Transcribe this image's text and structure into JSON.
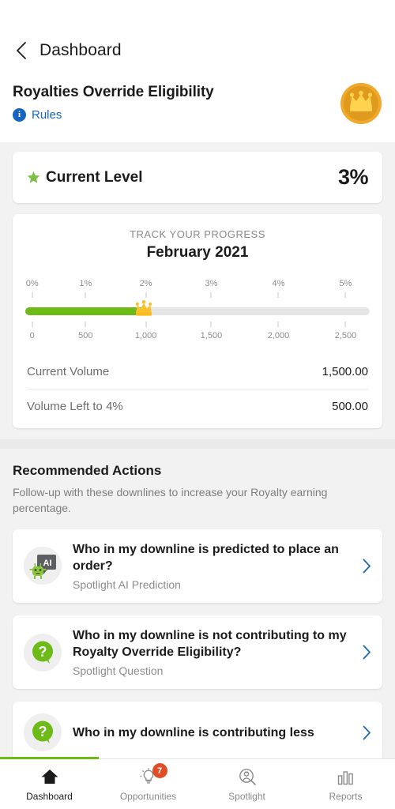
{
  "navbar": {
    "back_icon": "chevron-left-icon",
    "title": "Dashboard"
  },
  "header": {
    "page_title": "Royalties Override Eligibility",
    "rules_link": "Rules",
    "info_glyph": "i",
    "badge_icon": "crown-coin-icon"
  },
  "current_level": {
    "star_icon": "star-icon",
    "label": "Current Level",
    "value": "3%"
  },
  "progress": {
    "kicker": "TRACK YOUR PROGRESS",
    "month": "February 2021",
    "crown_icon": "crown-icon",
    "fill_percent": 34.5,
    "percent_ticks": [
      {
        "label": "0%",
        "pos": 2.0
      },
      {
        "label": "1%",
        "pos": 17.5
      },
      {
        "label": "2%",
        "pos": 35.0
      },
      {
        "label": "3%",
        "pos": 54.0
      },
      {
        "label": "4%",
        "pos": 73.5
      },
      {
        "label": "5%",
        "pos": 93.0
      }
    ],
    "volume_ticks": [
      {
        "label": "0",
        "pos": 2.0
      },
      {
        "label": "500",
        "pos": 17.5
      },
      {
        "label": "1,000",
        "pos": 35.0
      },
      {
        "label": "1,500",
        "pos": 54.0
      },
      {
        "label": "2,000",
        "pos": 73.5
      },
      {
        "label": "2,500",
        "pos": 93.0
      }
    ],
    "rows": [
      {
        "label": "Current Volume",
        "value": "1,500.00"
      },
      {
        "label": "Volume Left to 4%",
        "value": "500.00"
      }
    ]
  },
  "recommended": {
    "title": "Recommended Actions",
    "subtitle": "Follow-up with these downlines to increase your Royalty earning percentage.",
    "cards": [
      {
        "avatar_icon": "ai-robot-avatar-icon",
        "question": "Who in my downline is predicted to place an order?",
        "type": "Spotlight AI Prediction",
        "chevron_icon": "chevron-right-icon"
      },
      {
        "avatar_icon": "question-bubble-icon",
        "question": "Who in my downline is not contributing to my Royalty Override Eligibility?",
        "type": "Spotlight Question",
        "chevron_icon": "chevron-right-icon"
      },
      {
        "avatar_icon": "question-bubble-icon",
        "question": "Who in my downline is contributing less",
        "type": "",
        "chevron_icon": "chevron-right-icon"
      }
    ]
  },
  "tabbar": {
    "tabs": [
      {
        "label": "Dashboard",
        "icon": "home-icon",
        "badge": ""
      },
      {
        "label": "Opportunities",
        "icon": "lightbulb-icon",
        "badge": "7"
      },
      {
        "label": "Spotlight",
        "icon": "person-search-icon",
        "badge": ""
      },
      {
        "label": "Reports",
        "icon": "bar-chart-icon",
        "badge": ""
      }
    ]
  },
  "colors": {
    "accent_green": "#6cbb16",
    "link_blue": "#1565c0",
    "badge_orange": "#e04e27",
    "gold": "#f0b429"
  }
}
